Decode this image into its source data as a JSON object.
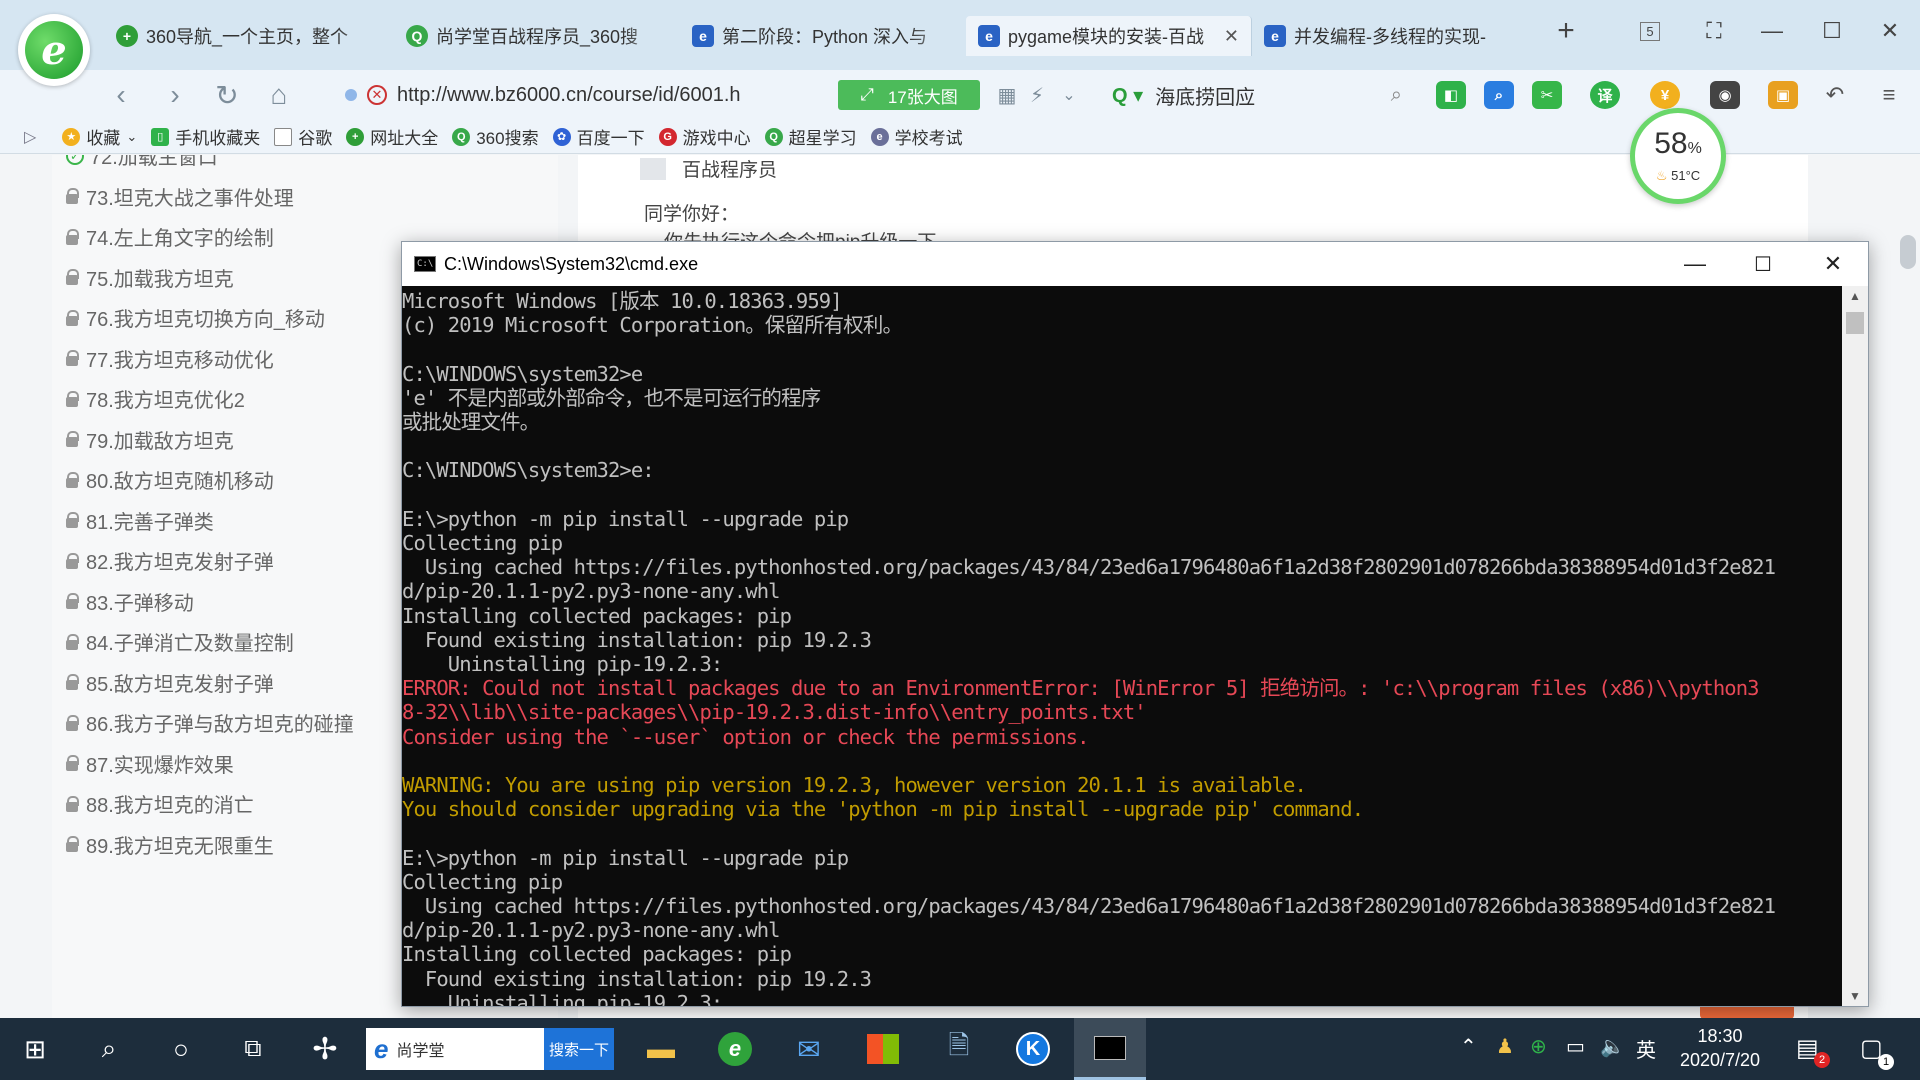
{
  "browser": {
    "tabs": [
      {
        "label": "360导航_一个主页，整个",
        "icon_color": "#2f9e38"
      },
      {
        "label": "尚学堂百战程序员_360搜",
        "icon_color": "#38a84a"
      },
      {
        "label": "第二阶段：Python 深入与",
        "icon_color": "#2a63c4"
      },
      {
        "label": "pygame模块的安装-百战",
        "icon_color": "#2a63c4"
      },
      {
        "label": "并发编程-多线程的实现-",
        "icon_color": "#2a63c4"
      }
    ],
    "active_tab": 3,
    "tab_count_badge": "5",
    "url": "http://www.bz6000.cn/course/id/6001.h",
    "big_image_button": "17张大图",
    "search_text": "海底捞回应",
    "bookmarks": [
      "收藏",
      "手机收藏夹",
      "谷歌",
      "网址大全",
      "360搜索",
      "百度一下",
      "游戏中心",
      "超星学习",
      "学校考试"
    ]
  },
  "perf_widget": {
    "percent": "58",
    "percent_unit": "%",
    "temp": "51°C"
  },
  "sidebar": {
    "lessons": [
      {
        "label": "72.加载主窗口",
        "done": true
      },
      {
        "label": "73.坦克大战之事件处理",
        "done": false
      },
      {
        "label": "74.左上角文字的绘制",
        "done": false
      },
      {
        "label": "75.加载我方坦克",
        "done": false
      },
      {
        "label": "76.我方坦克切换方向_移动",
        "done": false
      },
      {
        "label": "77.我方坦克移动优化",
        "done": false
      },
      {
        "label": "78.我方坦克优化2",
        "done": false
      },
      {
        "label": "79.加载敌方坦克",
        "done": false
      },
      {
        "label": "80.敌方坦克随机移动",
        "done": false
      },
      {
        "label": "81.完善子弹类",
        "done": false
      },
      {
        "label": "82.我方坦克发射子弹",
        "done": false
      },
      {
        "label": "83.子弹移动",
        "done": false
      },
      {
        "label": "84.子弹消亡及数量控制",
        "done": false
      },
      {
        "label": "85.敌方坦克发射子弹",
        "done": false
      },
      {
        "label": "86.我方子弹与敌方坦克的碰撞",
        "done": false
      },
      {
        "label": "87.实现爆炸效果",
        "done": false
      },
      {
        "label": "88.我方坦克的消亡",
        "done": false
      },
      {
        "label": "89.我方坦克无限重生",
        "done": false
      }
    ]
  },
  "content": {
    "reply_user": "百战程序员",
    "reply_greeting": "同学你好：",
    "reply_line": "你先执行这个命令把pip升级一下"
  },
  "cmd": {
    "title": "C:\\Windows\\System32\\cmd.exe",
    "lines": [
      {
        "t": "Microsoft Windows [版本 10.0.18363.959]",
        "c": "n"
      },
      {
        "t": "(c) 2019 Microsoft Corporation。保留所有权利。",
        "c": "n"
      },
      {
        "t": "",
        "c": "n"
      },
      {
        "t": "C:\\WINDOWS\\system32>e",
        "c": "n"
      },
      {
        "t": "'e' 不是内部或外部命令，也不是可运行的程序",
        "c": "n"
      },
      {
        "t": "或批处理文件。",
        "c": "n"
      },
      {
        "t": "",
        "c": "n"
      },
      {
        "t": "C:\\WINDOWS\\system32>e:",
        "c": "n"
      },
      {
        "t": "",
        "c": "n"
      },
      {
        "t": "E:\\>python -m pip install --upgrade pip",
        "c": "n"
      },
      {
        "t": "Collecting pip",
        "c": "n"
      },
      {
        "t": "  Using cached https://files.pythonhosted.org/packages/43/84/23ed6a1796480a6f1a2d38f2802901d078266bda38388954d01d3f2e821",
        "c": "n"
      },
      {
        "t": "d/pip-20.1.1-py2.py3-none-any.whl",
        "c": "n"
      },
      {
        "t": "Installing collected packages: pip",
        "c": "n"
      },
      {
        "t": "  Found existing installation: pip 19.2.3",
        "c": "n"
      },
      {
        "t": "    Uninstalling pip-19.2.3:",
        "c": "n"
      },
      {
        "t": "ERROR: Could not install packages due to an EnvironmentError: [WinError 5] 拒绝访问。: 'c:\\\\program files (x86)\\\\python3",
        "c": "e"
      },
      {
        "t": "8-32\\\\lib\\\\site-packages\\\\pip-19.2.3.dist-info\\\\entry_points.txt'",
        "c": "e"
      },
      {
        "t": "Consider using the `--user` option or check the permissions.",
        "c": "e"
      },
      {
        "t": "",
        "c": "n"
      },
      {
        "t": "WARNING: You are using pip version 19.2.3, however version 20.1.1 is available.",
        "c": "w"
      },
      {
        "t": "You should consider upgrading via the 'python -m pip install --upgrade pip' command.",
        "c": "w"
      },
      {
        "t": "",
        "c": "n"
      },
      {
        "t": "E:\\>python -m pip install --upgrade pip",
        "c": "n"
      },
      {
        "t": "Collecting pip",
        "c": "n"
      },
      {
        "t": "  Using cached https://files.pythonhosted.org/packages/43/84/23ed6a1796480a6f1a2d38f2802901d078266bda38388954d01d3f2e821",
        "c": "n"
      },
      {
        "t": "d/pip-20.1.1-py2.py3-none-any.whl",
        "c": "n"
      },
      {
        "t": "Installing collected packages: pip",
        "c": "n"
      },
      {
        "t": "  Found existing installation: pip 19.2.3",
        "c": "n"
      },
      {
        "t": "    Uninstalling pip-19.2.3:",
        "c": "n"
      }
    ]
  },
  "taskbar": {
    "search_placeholder": "尚学堂",
    "search_button": "搜索一下",
    "ime": "英",
    "time": "18:30",
    "date": "2020/7/20",
    "notify_badge": "2",
    "action_badge": "1"
  }
}
